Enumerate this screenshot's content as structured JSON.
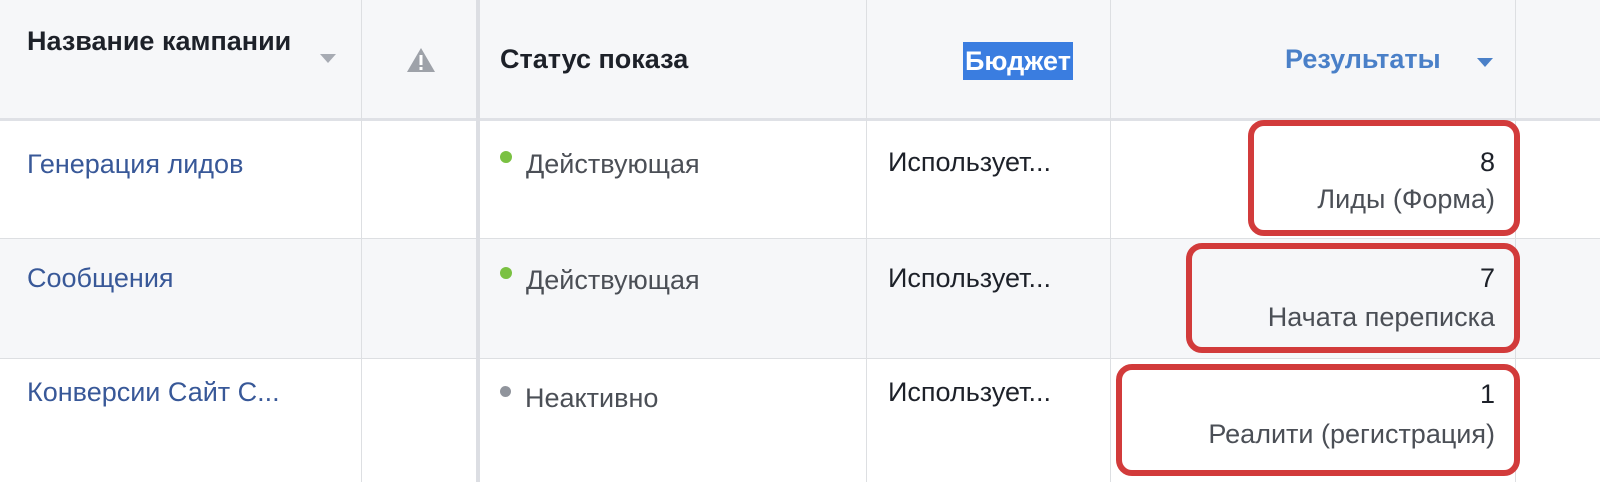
{
  "header": {
    "campaign_name": "Название кампании",
    "delivery_status": "Статус показа",
    "budget": "Бюджет",
    "results": "Результаты"
  },
  "icons": {
    "sort": "caret-down-icon",
    "warning": "warning-triangle-icon"
  },
  "colors": {
    "link": "#385898",
    "active_dot": "#7ac142",
    "inactive_dot": "#90949c",
    "highlight": "#d23b3b",
    "budget_selection": "#3a7de0"
  },
  "rows": [
    {
      "campaign": "Генерация лидов",
      "status": "Действующая",
      "status_kind": "active",
      "budget": "Использует...",
      "result_value": "8",
      "result_label": "Лиды (Форма)"
    },
    {
      "campaign": "Сообщения",
      "status": "Действующая",
      "status_kind": "active",
      "budget": "Использует...",
      "result_value": "7",
      "result_label": "Начата переписка"
    },
    {
      "campaign": "Конверсии Сайт С...",
      "status": "Неактивно",
      "status_kind": "inactive",
      "budget": "Использует...",
      "result_value": "1",
      "result_label": "Реалити (регистрация)"
    }
  ]
}
